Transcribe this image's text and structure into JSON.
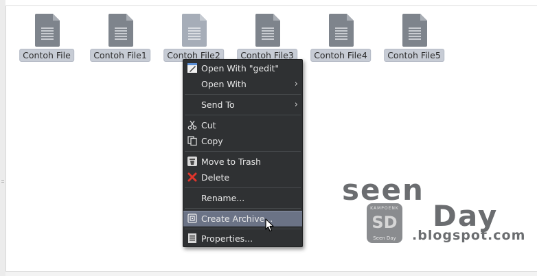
{
  "files": [
    {
      "name": "Contoh File"
    },
    {
      "name": "Contoh File1"
    },
    {
      "name": "Contoh File2"
    },
    {
      "name": "Contoh File3"
    },
    {
      "name": "Contoh File4"
    },
    {
      "name": "Contoh File5"
    }
  ],
  "context_menu": {
    "open_with_gedit_label": "Open With \"gedit\"",
    "open_with_label": "Open With",
    "send_to_label": "Send To",
    "cut_label": "Cut",
    "copy_label": "Copy",
    "move_to_trash_label": "Move to Trash",
    "delete_label": "Delete",
    "rename_label": "Rename...",
    "create_archive_label": "Create Archive...",
    "properties_label": "Properties..."
  },
  "watermark": {
    "line1": "seen",
    "line2": "Day",
    "domain": ".blogspot.com",
    "logo_top": "KAMPOENK",
    "logo_mark": "SD",
    "logo_bottom": "Seen Day"
  },
  "colors": {
    "menu_bg": "#2f3133",
    "menu_highlight": "#6b7386",
    "label_selected_bg": "#c7ccd5",
    "file_icon": "#7e848c",
    "delete_red": "#e0352b"
  }
}
